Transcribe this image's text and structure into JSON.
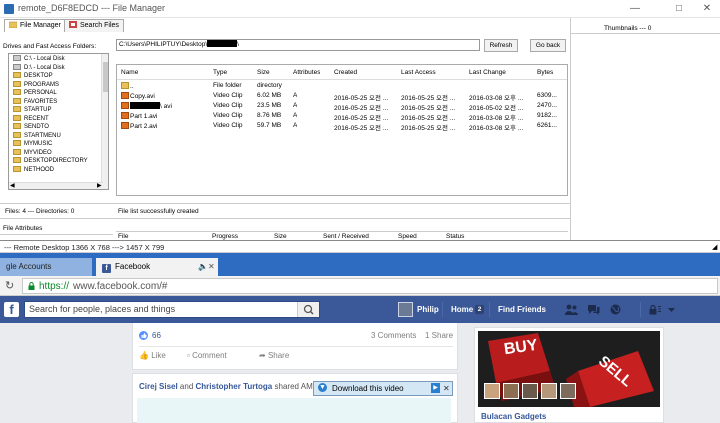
{
  "window": {
    "title": "remote_D6F8EDCD --- File Manager",
    "controls": [
      "—",
      "□",
      "✕"
    ]
  },
  "tabs": [
    {
      "label": "File Manager",
      "active": true
    },
    {
      "label": "Search Files",
      "active": false
    }
  ],
  "drives": {
    "label": "Drives and Fast Access Folders:",
    "items": [
      "C:\\ - Local Disk",
      "D:\\ - Local Disk",
      "DESKTOP",
      "PROGRAMS",
      "PERSONAL",
      "FAVORITES",
      "STARTUP",
      "RECENT",
      "SENDTO",
      "STARTMENU",
      "MYMUSIC",
      "MYVIDEO",
      "DESKTOPDIRECTORY",
      "NETHOOD"
    ]
  },
  "path": {
    "value": "C:\\Users\\PHILIPTUY\\Desktop\\",
    "suffix": "\\"
  },
  "buttons": {
    "refresh": "Refresh",
    "back": "Go back"
  },
  "files": {
    "columns": [
      "Name",
      "Type",
      "Size",
      "Attributes",
      "Created",
      "Last Access",
      "Last Change",
      "Bytes"
    ],
    "rows": [
      {
        "name": "..",
        "type": "File folder",
        "size": "directory",
        "attr": "",
        "created": "",
        "access": "",
        "change": "",
        "bytes": "",
        "icon": "folder"
      },
      {
        "name": "Copy.avi",
        "type": "Video Clip",
        "size": "6.02 MB",
        "attr": "A",
        "created": "2016-05-25 오전 ...",
        "access": "2016-05-25 오전 ...",
        "change": "2016-03-08 오후 ...",
        "bytes": "6309...",
        "icon": "video"
      },
      {
        "name": "\\ avi",
        "type": "Video Clip",
        "size": "23.5 MB",
        "attr": "A",
        "created": "2016-05-25 오전 ...",
        "access": "2016-05-25 오전 ...",
        "change": "2016-05-02 오전 ...",
        "bytes": "2470...",
        "icon": "video"
      },
      {
        "name": "Part 1.avi",
        "type": "Video Clip",
        "size": "8.76 MB",
        "attr": "A",
        "created": "2016-05-25 오전 ...",
        "access": "2016-05-25 오전 ...",
        "change": "2016-03-08 오후 ...",
        "bytes": "9182...",
        "icon": "video"
      },
      {
        "name": "Part 2.avi",
        "type": "Video Clip",
        "size": "59.7 MB",
        "attr": "A",
        "created": "2016-05-25 오전 ...",
        "access": "2016-05-25 오전 ...",
        "change": "2016-03-08 오후 ...",
        "bytes": "6261...",
        "icon": "video"
      }
    ]
  },
  "status": {
    "counts": "Files: 4 --- Directories: 0",
    "message": "File list successfully created"
  },
  "thumbnails": "Thumbnails --- 0",
  "file_attributes_tab": "File Attributes",
  "transfer_columns": [
    "File",
    "Progress",
    "Size",
    "Sent / Received",
    "Speed",
    "Status"
  ],
  "remote_desktop": "--- Remote Desktop 1366 X 768 ---> 1457 X 799",
  "browser": {
    "tabs": [
      {
        "label": "gle Accounts",
        "active": false
      },
      {
        "label": "Facebook",
        "active": true
      }
    ],
    "tab_close": "✕",
    "url_scheme": "https://",
    "url_rest": "www.facebook.com/#"
  },
  "facebook": {
    "logo": "f",
    "search_placeholder": "Search for people, places and things",
    "user": "Philip",
    "home": "Home",
    "home_count": "2",
    "find_friends": "Find Friends",
    "likes": "66",
    "comments": "3 Comments",
    "shares": "1 Share",
    "actions": [
      "Like",
      "Comment",
      "Share"
    ],
    "shared_line": {
      "a": "Cirej Sisel",
      "and": "and",
      "b": "Christopher Turtoga",
      "rest": "shared AM"
    },
    "download": "Download this video",
    "ad_title": "Bulacan Gadgets",
    "ad_word1": "BUY",
    "ad_word2": "SELL"
  }
}
